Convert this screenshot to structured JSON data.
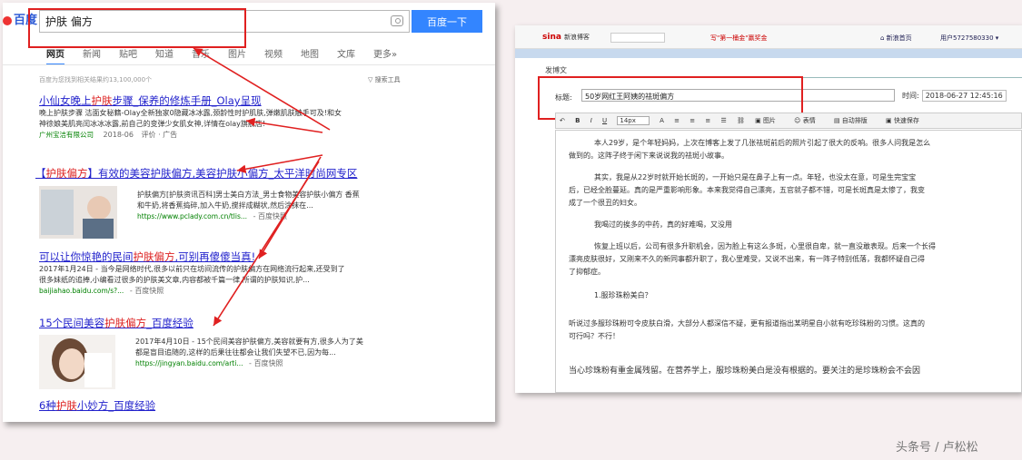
{
  "baidu": {
    "logo": "百度",
    "search_value": "护肤 偏方",
    "search_button": "百度一下",
    "tabs": [
      "网页",
      "新闻",
      "贴吧",
      "知道",
      "音乐",
      "图片",
      "视频",
      "地图",
      "文库",
      "更多»"
    ],
    "result_count": "百度为您找到相关结果约13,100,000个",
    "search_tools": "搜索工具",
    "results": [
      {
        "title_a": "小仙女晚上",
        "title_b": "护肤",
        "title_c": "步骤_保养的修炼手册_Olay呈现",
        "desc_line1": "晚上护肤步骤 洁面女秘籍-Olay全新独家0隐藏冰冰露,颈龄性时护肌肤,弹嫩肌肤触手可及!和女",
        "desc_line2": "神徐娘美肌亮闰冰冰冰露,前自己的变弹少女肌女神,详情在olay旗舰店!",
        "source": "广州宝洁有限公司",
        "date": "2018-06",
        "extra": "评价 · 广告"
      },
      {
        "title_a": "【",
        "title_b": "护肤偏方",
        "title_c": "】有效的美容护肤偏方,美容护肤小偏方_太平洋时尚网专区",
        "desc_line1": "护肤偏方[护肤资讯百科]男士美白方法_男士食物美容护肤小偏方 香蕉",
        "desc_line2": "和牛奶,将香蕉捣碎,加入牛奶,搅拌成糊状,然后涂抹在...",
        "url": "https://www.pclady.com.cn/tlis...",
        "snapshot": "百度快照"
      },
      {
        "title_a": "可以让你惊艳的民间",
        "title_b": "护肤偏方",
        "title_c": ",可别再傻傻当真!",
        "desc_line1": "2017年1月24日 - 当今是网络时代,很多以前只在坊间流传的护肤偏方在网络流行起来,还受到了",
        "desc_line2": "很多妹纸的追捧,小编看过很多的护肤美文章,内容都被千篇一律,所谓的护肤知识,护...",
        "url": "baijiahao.baidu.com/s?...",
        "snapshot": "百度快照"
      },
      {
        "title_a": "15个民间美容",
        "title_b": "护肤偏方",
        "title_c": "_百度经验",
        "desc_line1": "2017年4月10日 - 15个民间美容护肤偏方,美容就要有方,很多人为了美",
        "desc_line2": "都是盲目追随的,这样的后果往往都会让我们失望不已,因为每...",
        "url": "https://jingyan.baidu.com/arti...",
        "snapshot": "百度快照"
      },
      {
        "title_a": "6种",
        "title_b": "护肤",
        "title_c": "小妙方_百度经验"
      }
    ]
  },
  "sina": {
    "logo": "sina",
    "logo_sub": "新浪博客",
    "activity": "写\"第一桶金\"赢奖金",
    "nav_home": "新浪首页",
    "user": "用户5727580330",
    "compose_label": "发博文",
    "title_label": "标题:",
    "title_value": "50岁网红王阿姨的祛斑偏方",
    "time_label": "时间:",
    "time_value": "2018-06-27 12:45:16",
    "toolbar": {
      "font_size": "14px",
      "image": "图片",
      "emoji": "表情",
      "auto_layout": "自动排版",
      "quick_save": "快速保存"
    },
    "paragraphs": [
      "本人29岁，是个年轻妈妈，上次在博客上发了几张祛斑前后的照片引起了很大的反响。很多人问我是怎么",
      "做到的。这阵子终于闲下来说说我的祛斑小故事。",
      "其实，我是从22岁时就开始长斑的，一开始只是在鼻子上有一点。年轻，也没太在意，可是生完宝宝",
      "后，已经全脸蔓延。真的是严重影响形象。本来我觉得自己漂亮，五官就子都不错，可是长斑真是太惨了，我变",
      "成了一个很丑的妇女。",
      "我喝过的挨多的中药，真的好难喝，又没用",
      "恢复上班以后，公司有很多升职机会，因为脸上有这么多斑，心里很自卑，就一直没敢表现。后来一个长得",
      "漂亮皮肤很好，又刚来不久的新同事都升职了，我心里难受，又说不出来，有一阵子特别低落，我都怀疑自己得",
      "了抑郁症。",
      "1.服珍珠粉美白？",
      "听说过多服珍珠粉可令皮肤白滑，大部分人都深信不疑，更有报道指出某明星自小就有吃珍珠粉的习惯。这真的",
      "可行吗？不行！",
      "当心珍珠粉有重金属残留。在营养学上，服珍珠粉美白是没有根据的。要关注的是珍珠粉会不会因"
    ]
  },
  "watermark": "头条号 / 卢松松",
  "colors": {
    "baidu_blue": "#3385ff",
    "link_blue": "#2222cc",
    "highlight_red": "#dd2222",
    "url_green": "#008000",
    "annotation_red": "#e02020"
  }
}
